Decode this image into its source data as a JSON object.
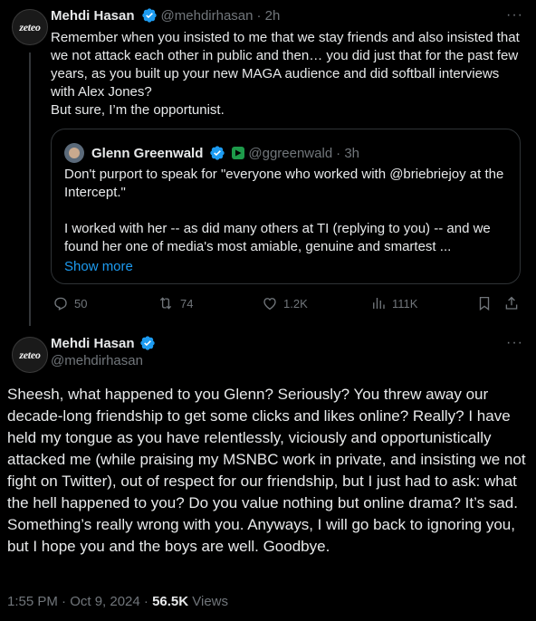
{
  "reply_tweet": {
    "author_name": "Mehdi Hasan",
    "author_handle": "@mehdirhasan",
    "time": "· 2h",
    "avatar_text": "zeteo",
    "text": "Remember when you insisted to me that we stay friends and also insisted that we not attack each other in public and then… you did just that for the past few years, as you built up your new MAGA audience and did softball interviews with Alex Jones?",
    "text_line2": "But sure, I’m the opportunist.",
    "quoted": {
      "author_name": "Glenn Greenwald",
      "author_handle": "@ggreenwald",
      "time": "· 3h",
      "text_p1": "Don't purport to speak for \"everyone who worked with @briebriejoy at the Intercept.\"",
      "text_p2": "I worked with her -- as did many others at TI (replying to you) -- and we found her one of media's most amiable, genuine and smartest ...",
      "show_more": "Show more"
    },
    "stats": {
      "replies": "50",
      "reposts": "74",
      "likes": "1.2K",
      "views": "111K"
    }
  },
  "main_tweet": {
    "author_name": "Mehdi Hasan",
    "author_handle": "@mehdirhasan",
    "avatar_text": "zeteo",
    "text": "Sheesh, what happened to you Glenn? Seriously? You threw away our decade-long friendship to get some clicks and likes online? Really? I have held my tongue as you have relentlessly, viciously and opportunistically attacked me (while praising my MSNBC work in private, and insisting we not fight on Twitter), out of respect for our friendship, but I just had to ask: what the hell happened to you? Do you value nothing but online drama? It’s sad. Something’s really wrong with you. Anyways, I will go back to ignoring you, but I hope you and the boys are well. Goodbye.",
    "timestamp": "1:55 PM · Oct 9, 2024 · ",
    "views_count": "56.5K",
    "views_label": " Views"
  },
  "colors": {
    "background": "#000000",
    "text": "#e7e9ea",
    "muted": "#71767b",
    "link": "#1d9bf0",
    "verified": "#1d9bf0",
    "border": "#2f3336"
  },
  "icons": [
    "verified-badge-icon",
    "more-icon",
    "reply-icon",
    "repost-icon",
    "like-icon",
    "views-icon",
    "bookmark-icon",
    "share-icon",
    "media-badge-icon"
  ]
}
